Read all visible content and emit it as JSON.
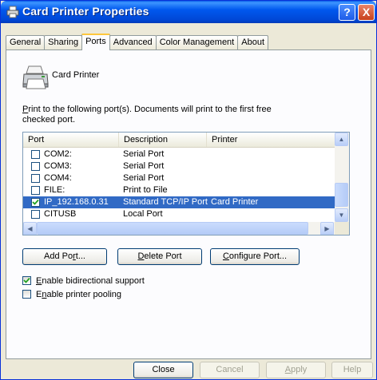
{
  "window": {
    "title": "Card Printer Properties",
    "help_glyph": "?",
    "close_glyph": "X"
  },
  "tabs": [
    {
      "label": "General"
    },
    {
      "label": "Sharing"
    },
    {
      "label": "Ports",
      "active": true
    },
    {
      "label": "Advanced"
    },
    {
      "label": "Color Management"
    },
    {
      "label": "About"
    }
  ],
  "printer": {
    "name": "Card Printer",
    "icon": "printer-icon"
  },
  "instruction": {
    "first_letter": "P",
    "text": "rint to the following port(s). Documents will print to the first free checked port."
  },
  "port_list": {
    "columns": [
      "Port",
      "Description",
      "Printer"
    ],
    "rows": [
      {
        "port": "COM2:",
        "description": "Serial Port",
        "printer": "",
        "checked": false,
        "selected": false
      },
      {
        "port": "COM3:",
        "description": "Serial Port",
        "printer": "",
        "checked": false,
        "selected": false
      },
      {
        "port": "COM4:",
        "description": "Serial Port",
        "printer": "",
        "checked": false,
        "selected": false
      },
      {
        "port": "FILE:",
        "description": "Print to File",
        "printer": "",
        "checked": false,
        "selected": false
      },
      {
        "port": "IP_192.168.0.31",
        "description": "Standard TCP/IP Port",
        "printer": "Card Printer",
        "checked": true,
        "selected": true
      },
      {
        "port": "CITUSB",
        "description": "Local Port",
        "printer": "",
        "checked": false,
        "selected": false
      }
    ]
  },
  "buttons": {
    "add_port": {
      "pre": "Add Po",
      "key": "r",
      "post": "t..."
    },
    "delete_port": {
      "pre": "",
      "key": "D",
      "post": "elete Port"
    },
    "configure_port": {
      "pre": "",
      "key": "C",
      "post": "onfigure Port..."
    }
  },
  "options": {
    "bidirectional": {
      "key": "E",
      "rest": "nable bidirectional support",
      "checked": true
    },
    "pooling": {
      "pre": "E",
      "key": "n",
      "rest": "able printer pooling",
      "checked": false
    }
  },
  "footer": {
    "close": "Close",
    "cancel": "Cancel",
    "apply_key": "A",
    "apply_rest": "pply",
    "help": "Help"
  },
  "colors": {
    "accent": "#316ac5",
    "titlebar": "#0058ee",
    "face": "#ece9d8"
  }
}
